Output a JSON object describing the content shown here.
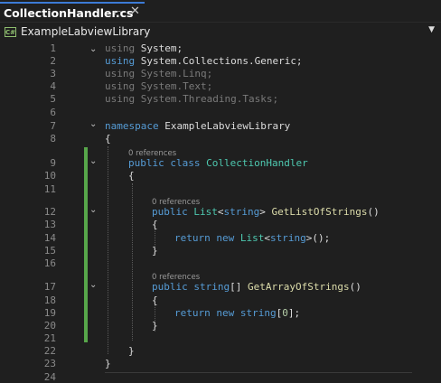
{
  "tab": {
    "title": "CollectionHandler.cs",
    "pin_icon": "pin-icon",
    "close_icon": "close-icon"
  },
  "navbar": {
    "project": "ExampleLabviewLibrary",
    "icon": "csharp-project-icon"
  },
  "codelens": "0 references",
  "lines": [
    {
      "n": "1",
      "text": "using System;"
    },
    {
      "n": "2",
      "text": "using System.Collections.Generic;"
    },
    {
      "n": "3",
      "text": "using System.Linq;"
    },
    {
      "n": "4",
      "text": "using System.Text;"
    },
    {
      "n": "5",
      "text": "using System.Threading.Tasks;"
    },
    {
      "n": "6",
      "text": ""
    },
    {
      "n": "7",
      "text": "namespace ExampleLabviewLibrary"
    },
    {
      "n": "8",
      "text": "{"
    },
    {
      "n": "9",
      "text": "public class CollectionHandler"
    },
    {
      "n": "10",
      "text": "{"
    },
    {
      "n": "11",
      "text": ""
    },
    {
      "n": "12",
      "text": "public List<string> GetListOfStrings()"
    },
    {
      "n": "13",
      "text": "{"
    },
    {
      "n": "14",
      "text": "return new List<string>();"
    },
    {
      "n": "15",
      "text": "}"
    },
    {
      "n": "16",
      "text": ""
    },
    {
      "n": "17",
      "text": "public string[] GetArrayOfStrings()"
    },
    {
      "n": "18",
      "text": "{"
    },
    {
      "n": "19",
      "text": "return new string[0];"
    },
    {
      "n": "20",
      "text": "}"
    },
    {
      "n": "21",
      "text": ""
    },
    {
      "n": "22",
      "text": "}"
    },
    {
      "n": "23",
      "text": "}"
    },
    {
      "n": "24",
      "text": ""
    }
  ]
}
